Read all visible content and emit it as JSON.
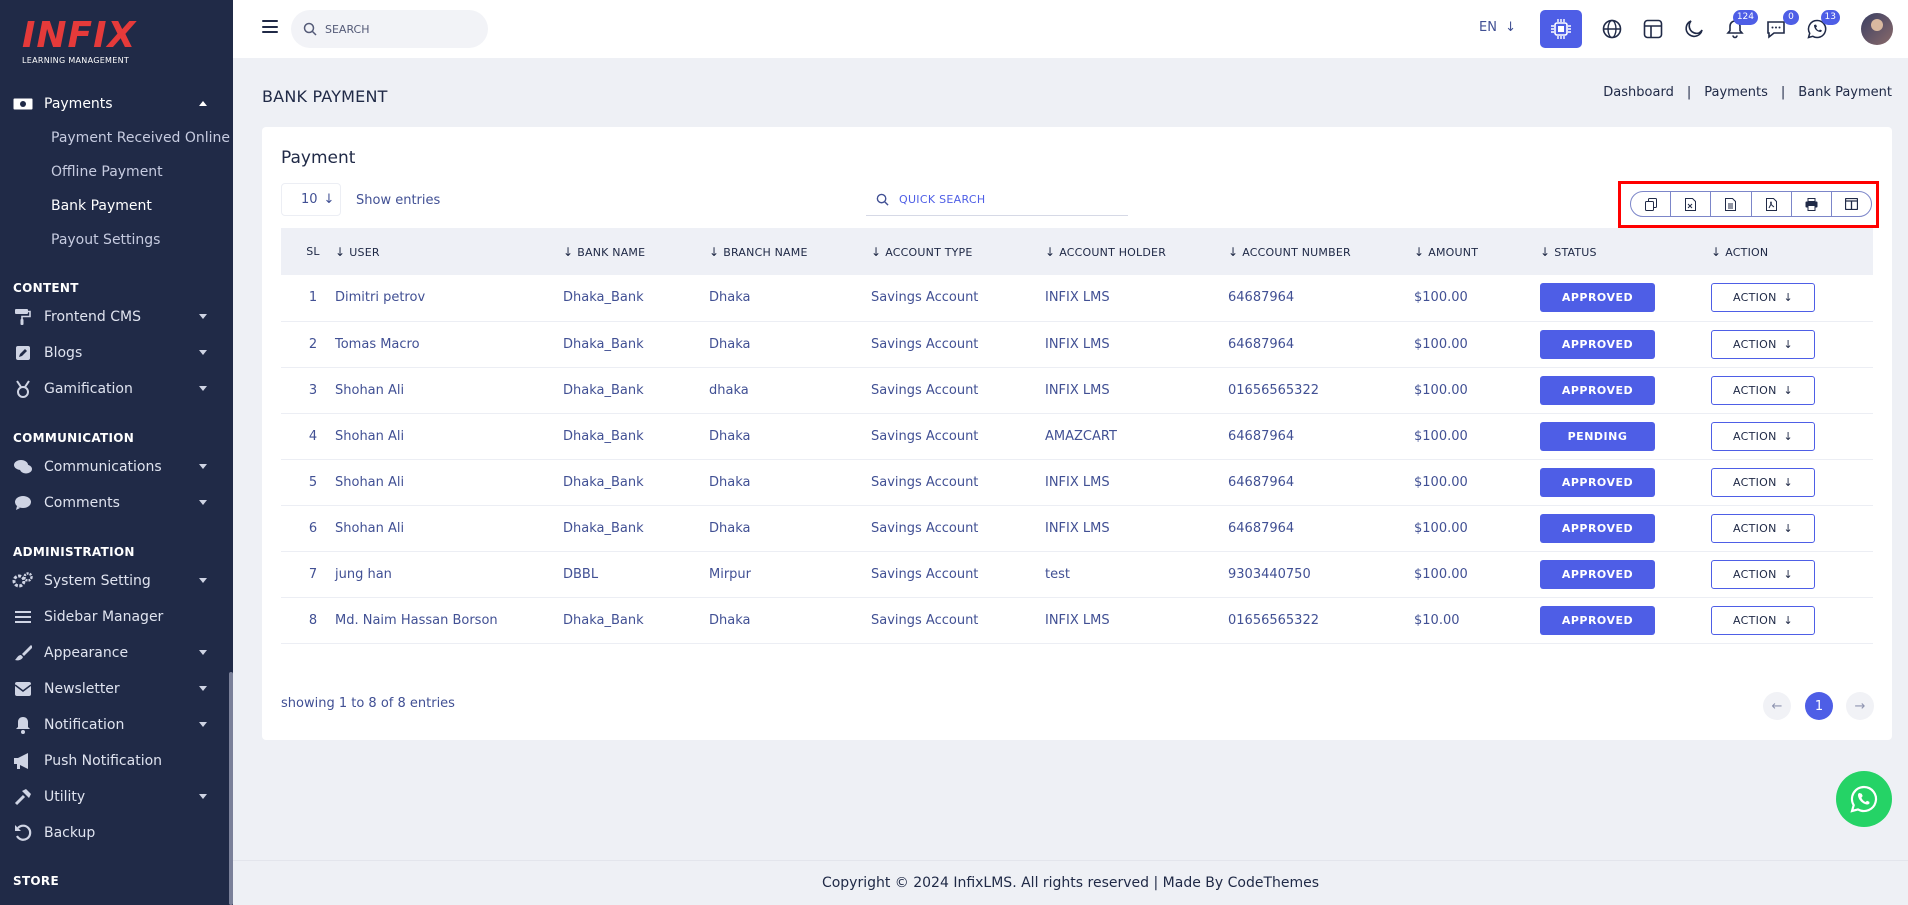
{
  "logo": {
    "main": "INFIX",
    "sub": "LEARNING MANAGEMENT"
  },
  "sidebar": {
    "payments": {
      "label": "Payments",
      "subs": [
        "Payment Received Online",
        "Offline Payment",
        "Bank Payment",
        "Payout Settings"
      ]
    },
    "sections": {
      "content": "CONTENT",
      "communication": "COMMUNICATION",
      "administration": "ADMINISTRATION",
      "store": "STORE"
    },
    "content_items": [
      "Frontend CMS",
      "Blogs",
      "Gamification"
    ],
    "communication_items": [
      "Communications",
      "Comments"
    ],
    "admin_items": [
      "System Setting",
      "Sidebar Manager",
      "Appearance",
      "Newsletter",
      "Notification",
      "Push Notification",
      "Utility",
      "Backup"
    ]
  },
  "topbar": {
    "search_placeholder": "SEARCH",
    "lang": "EN",
    "badges": {
      "notifications": "124",
      "messages": "0",
      "whatsapp": "13"
    }
  },
  "page": {
    "title": "BANK PAYMENT",
    "breadcrumb": [
      "Dashboard",
      "Payments",
      "Bank Payment"
    ],
    "breadcrumb_sep": "|"
  },
  "card": {
    "title": "Payment",
    "entries": "10",
    "show_entries": "Show entries",
    "quick_search_placeholder": "QUICK SEARCH",
    "columns": [
      "SL",
      "USER",
      "BANK NAME",
      "BRANCH NAME",
      "ACCOUNT TYPE",
      "ACCOUNT HOLDER",
      "ACCOUNT NUMBER",
      "AMOUNT",
      "STATUS",
      "ACTION"
    ],
    "action_label": "ACTION",
    "rows": [
      {
        "sl": "1",
        "user": "Dimitri petrov",
        "bank": "Dhaka_Bank",
        "branch": "Dhaka",
        "type": "Savings Account",
        "holder": "INFIX LMS",
        "number": "64687964",
        "amount": "$100.00",
        "status": "APPROVED"
      },
      {
        "sl": "2",
        "user": "Tomas Macro",
        "bank": "Dhaka_Bank",
        "branch": "Dhaka",
        "type": "Savings Account",
        "holder": "INFIX LMS",
        "number": "64687964",
        "amount": "$100.00",
        "status": "APPROVED"
      },
      {
        "sl": "3",
        "user": "Shohan Ali",
        "bank": "Dhaka_Bank",
        "branch": "dhaka",
        "type": "Savings Account",
        "holder": "INFIX LMS",
        "number": "01656565322",
        "amount": "$100.00",
        "status": "APPROVED"
      },
      {
        "sl": "4",
        "user": "Shohan Ali",
        "bank": "Dhaka_Bank",
        "branch": "Dhaka",
        "type": "Savings Account",
        "holder": "AMAZCART",
        "number": "64687964",
        "amount": "$100.00",
        "status": "PENDING"
      },
      {
        "sl": "5",
        "user": "Shohan Ali",
        "bank": "Dhaka_Bank",
        "branch": "Dhaka",
        "type": "Savings Account",
        "holder": "INFIX LMS",
        "number": "64687964",
        "amount": "$100.00",
        "status": "APPROVED"
      },
      {
        "sl": "6",
        "user": "Shohan Ali",
        "bank": "Dhaka_Bank",
        "branch": "Dhaka",
        "type": "Savings Account",
        "holder": "INFIX LMS",
        "number": "64687964",
        "amount": "$100.00",
        "status": "APPROVED"
      },
      {
        "sl": "7",
        "user": "jung han",
        "bank": "DBBL",
        "branch": "Mirpur",
        "type": "Savings Account",
        "holder": "test",
        "number": "9303440750",
        "amount": "$100.00",
        "status": "APPROVED"
      },
      {
        "sl": "8",
        "user": "Md. Naim Hassan Borson",
        "bank": "Dhaka_Bank",
        "branch": "Dhaka",
        "type": "Savings Account",
        "holder": "INFIX LMS",
        "number": "01656565322",
        "amount": "$10.00",
        "status": "APPROVED"
      }
    ],
    "showing": "showing 1 to 8 of 8 entries",
    "current_page": "1"
  },
  "footer": "Copyright © 2024 InfixLMS. All rights reserved | Made By CodeThemes",
  "colors": {
    "sidebar": "#202a47",
    "accent": "#4e5ee6",
    "logo": "#e53a3a",
    "whatsapp": "#25d366",
    "highlight": "#ff0000"
  }
}
